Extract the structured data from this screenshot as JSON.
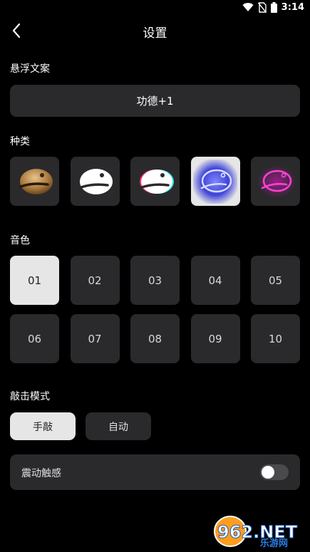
{
  "status": {
    "time": "3:14"
  },
  "nav": {
    "title": "设置"
  },
  "float_text": {
    "label": "悬浮文案",
    "value": "功德+1"
  },
  "types": {
    "label": "种类",
    "items": [
      {
        "icon": "wooden-fish-natural-icon"
      },
      {
        "icon": "wooden-fish-white-icon"
      },
      {
        "icon": "wooden-fish-glitch-icon"
      },
      {
        "icon": "wooden-fish-blue-neon-icon"
      },
      {
        "icon": "wooden-fish-pink-neon-icon"
      }
    ],
    "selected_index": 3
  },
  "tones": {
    "label": "音色",
    "items": [
      "01",
      "02",
      "03",
      "04",
      "05",
      "06",
      "07",
      "08",
      "09",
      "10"
    ],
    "selected": "01"
  },
  "mode": {
    "label": "敲击模式",
    "options": [
      "手敲",
      "自动"
    ],
    "selected": "手敲"
  },
  "vibrate": {
    "label": "震动触感",
    "enabled": false
  },
  "watermark": {
    "text_main": "962.NET",
    "text_sub": "乐游网"
  },
  "colors": {
    "background": "#000000",
    "card": "#2a2a2c",
    "selected": "#e6e6e6",
    "neon_blue": "#7f86ff",
    "neon_pink": "#ff3fd4"
  }
}
